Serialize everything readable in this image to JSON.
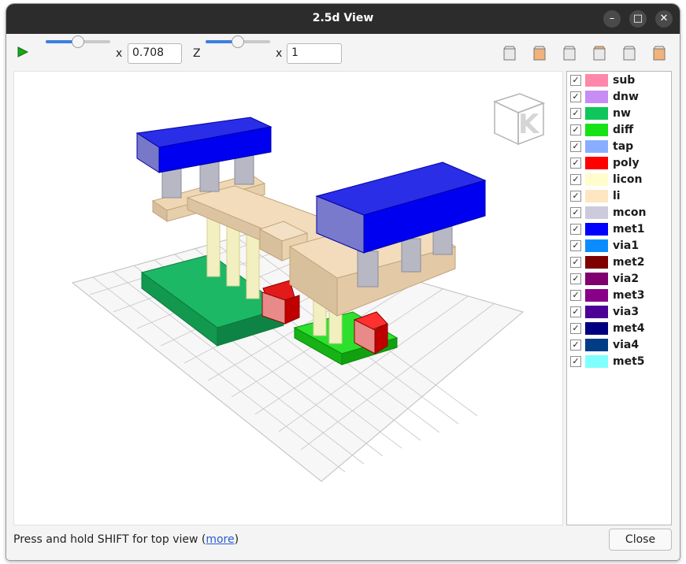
{
  "window": {
    "title": "2.5d View",
    "controls": {
      "minimize": "–",
      "maximize": "□",
      "close": "✕"
    }
  },
  "toolbar": {
    "play_icon": "play-icon",
    "x_scale": {
      "label": "x",
      "value": "0.708",
      "slider_fraction": 0.5
    },
    "z_label": "Z",
    "z_scale": {
      "label": "x",
      "value": "1",
      "slider_fraction": 0.5
    },
    "view_buttons": [
      "front-view-icon",
      "top-view-icon",
      "left-view-icon",
      "bottom-view-icon",
      "right-view-icon",
      "back-view-icon"
    ]
  },
  "layers": [
    {
      "name": "sub",
      "color": "#ff88aa",
      "checked": true
    },
    {
      "name": "dnw",
      "color": "#c88cf5",
      "checked": true
    },
    {
      "name": "nw",
      "color": "#0fc65a",
      "checked": true
    },
    {
      "name": "diff",
      "color": "#16e216",
      "checked": true
    },
    {
      "name": "tap",
      "color": "#8aaeff",
      "checked": true
    },
    {
      "name": "poly",
      "color": "#ff0000",
      "checked": true
    },
    {
      "name": "licon",
      "color": "#fffdcb",
      "checked": true
    },
    {
      "name": "li",
      "color": "#ffe6c2",
      "checked": true
    },
    {
      "name": "mcon",
      "color": "#cbcbdd",
      "checked": true
    },
    {
      "name": "met1",
      "color": "#0000ff",
      "checked": true
    },
    {
      "name": "via1",
      "color": "#0a8cff",
      "checked": true
    },
    {
      "name": "met2",
      "color": "#7f0000",
      "checked": true
    },
    {
      "name": "via2",
      "color": "#7f006e",
      "checked": true
    },
    {
      "name": "met3",
      "color": "#880088",
      "checked": true
    },
    {
      "name": "via3",
      "color": "#4d0095",
      "checked": true
    },
    {
      "name": "met4",
      "color": "#00007f",
      "checked": true
    },
    {
      "name": "via4",
      "color": "#003d86",
      "checked": true
    },
    {
      "name": "met5",
      "color": "#80ffff",
      "checked": true
    }
  ],
  "status": {
    "text": "Press and hold SHIFT for top view (",
    "link": "more",
    "suffix": ")"
  },
  "close_button": "Close"
}
